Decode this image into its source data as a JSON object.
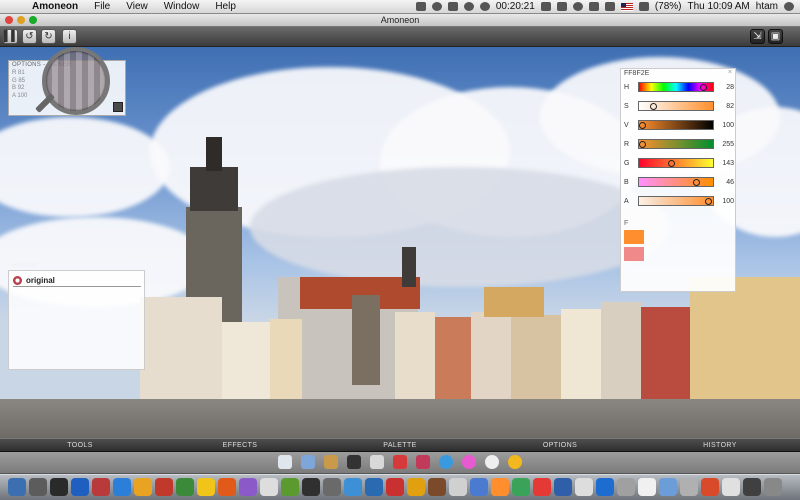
{
  "menubar": {
    "apple": "",
    "app_name": "Amoneon",
    "menus": [
      "File",
      "View",
      "Window",
      "Help"
    ],
    "clock_timer": "00:20:21",
    "battery": "(78%)",
    "datetime": "Thu 10:09 AM",
    "user": "htam"
  },
  "window": {
    "title": "Amoneon"
  },
  "toolbar": {
    "left_buttons": [
      {
        "name": "panel-toggle-button",
        "glyph": "▌▌"
      },
      {
        "name": "undo-button",
        "glyph": "↺"
      },
      {
        "name": "redo-button",
        "glyph": "↻"
      },
      {
        "name": "info-button",
        "glyph": "i"
      }
    ],
    "right_buttons": [
      {
        "name": "export-button",
        "glyph": "⇲"
      },
      {
        "name": "copy-button",
        "glyph": "▣"
      }
    ]
  },
  "picker_panel": {
    "title": "OPTIONS - PICKER",
    "rows": [
      {
        "label": "R",
        "value": "81"
      },
      {
        "label": "G",
        "value": "85"
      },
      {
        "label": "B",
        "value": "92"
      },
      {
        "label": "A",
        "value": "100"
      }
    ],
    "swatch_color": "#4a4a4a"
  },
  "color_panel": {
    "hex": "FF8F2E",
    "close": "×",
    "channels": [
      {
        "label": "H",
        "value": "28",
        "fraction": 0.93,
        "gradient": "linear-gradient(90deg,#f00,#ff0,#0f0,#0ff,#00f,#f0f,#f00)"
      },
      {
        "label": "S",
        "value": "82",
        "fraction": 0.16,
        "gradient": "linear-gradient(90deg,#fff,#ff8f2e)"
      },
      {
        "label": "V",
        "value": "100",
        "fraction": 0.0,
        "gradient": "linear-gradient(90deg,#ff8f2e,#000)"
      },
      {
        "label": "R",
        "value": "255",
        "fraction": 0.0,
        "gradient": "linear-gradient(90deg,#ff8f2e,#008f2e)"
      },
      {
        "label": "G",
        "value": "143",
        "fraction": 0.44,
        "gradient": "linear-gradient(90deg,#ff002e,#ffff2e)"
      },
      {
        "label": "B",
        "value": "46",
        "fraction": 0.82,
        "gradient": "linear-gradient(90deg,#ff8fff,#ff8f00)"
      },
      {
        "label": "A",
        "value": "100",
        "fraction": 1.0,
        "gradient": "linear-gradient(90deg,rgba(255,143,46,0.1),#ff8f2e)"
      }
    ],
    "f_label": "F",
    "swatch_fg": "#ff8f2e",
    "swatch_bg": "#f08a8a"
  },
  "history_panel": {
    "title": "HISTORY",
    "items": [
      {
        "label": "original"
      }
    ]
  },
  "tabs": [
    "TOOLS",
    "EFFECTS",
    "PALETTE",
    "OPTIONS",
    "HISTORY"
  ],
  "tools": [
    {
      "name": "document-tool-icon",
      "color": "#dfe6ee"
    },
    {
      "name": "brush-tool-icon",
      "color": "#7ea6d8"
    },
    {
      "name": "broom-tool-icon",
      "color": "#c89a4a"
    },
    {
      "name": "stamp-tool-icon",
      "color": "#333333"
    },
    {
      "name": "eraser-tool-icon",
      "color": "#d8d8d8"
    },
    {
      "name": "fill-tool-icon",
      "color": "#d63a3a"
    },
    {
      "name": "marker-tool-icon",
      "color": "#c23a5a"
    },
    {
      "name": "color-dots-tool-icon",
      "color": "#3a9ae0"
    },
    {
      "name": "color-wheel-tool-icon",
      "color": "#e85ad0"
    },
    {
      "name": "contrast-tool-icon",
      "color": "#eeeeee"
    },
    {
      "name": "sun-tool-icon",
      "color": "#f2b81e"
    }
  ],
  "dock": [
    "#3c6fb0",
    "#5c5c5c",
    "#2a2a2a",
    "#1f5fbf",
    "#b83a3a",
    "#2c7fd8",
    "#e8a323",
    "#c0392b",
    "#3a8a3a",
    "#f0c419",
    "#e25a1a",
    "#8c5ac8",
    "#dddddd",
    "#5a9a2e",
    "#303030",
    "#6a6a6a",
    "#3d8fd6",
    "#2a6ab0",
    "#c93030",
    "#e0a010",
    "#7a4a2a",
    "#d0d0d0",
    "#4b7bd0",
    "#ff8f2e",
    "#3aa35a",
    "#e53935",
    "#2f5fa8",
    "#dddddd",
    "#1d6dd0",
    "#a0a0a0",
    "#f0f0f0",
    "#6b9ed8",
    "#b0b0b0",
    "#d94a2a",
    "#e0e0e0",
    "#404040",
    "#888888"
  ]
}
